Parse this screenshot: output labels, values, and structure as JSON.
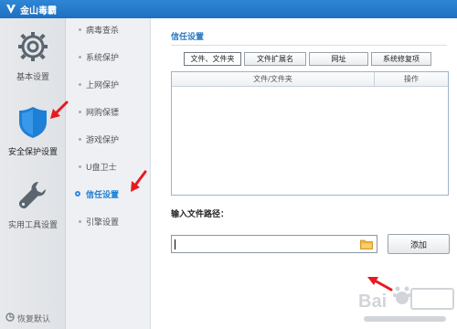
{
  "app": {
    "title": "金山毒霸",
    "logo_icon": "v-shield-icon"
  },
  "categories": [
    {
      "label": "基本设置",
      "icon": "gear-icon",
      "active": false
    },
    {
      "label": "安全保护设置",
      "icon": "shield-icon",
      "active": true
    },
    {
      "label": "实用工具设置",
      "icon": "wrench-icon",
      "active": false
    }
  ],
  "restore_label": "恢复默认",
  "nav": {
    "items": [
      {
        "label": "病毒查杀",
        "active": false
      },
      {
        "label": "系统保护",
        "active": false
      },
      {
        "label": "上网保护",
        "active": false
      },
      {
        "label": "网购保镖",
        "active": false
      },
      {
        "label": "游戏保护",
        "active": false
      },
      {
        "label": "U盘卫士",
        "active": false
      },
      {
        "label": "信任设置",
        "active": true
      },
      {
        "label": "引擎设置",
        "active": false
      }
    ]
  },
  "content": {
    "section_title": "信任设置",
    "tabs": [
      {
        "label": "文件、文件夹",
        "active": true
      },
      {
        "label": "文件扩展名",
        "active": false
      },
      {
        "label": "网址",
        "active": false
      },
      {
        "label": "系统修复项",
        "active": false
      }
    ],
    "table": {
      "columns": [
        "文件/文件夹",
        "操作"
      ],
      "rows": []
    },
    "path_label": "输入文件路径：",
    "path_value": "",
    "add_button": "添加"
  },
  "colors": {
    "titlebar": "#1f6fbf",
    "accent": "#2b8ae0",
    "annotation_arrow": "#e8191e"
  }
}
